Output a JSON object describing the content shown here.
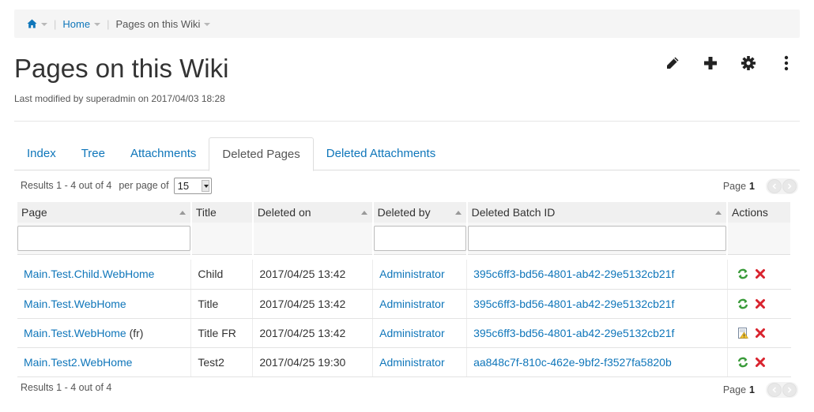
{
  "breadcrumb": {
    "home_label": "Home",
    "current": "Pages on this Wiki"
  },
  "page": {
    "title": "Pages on this Wiki",
    "modified": "Last modified by superadmin on 2017/04/03 18:28"
  },
  "top_actions": [
    "pencil-icon",
    "plus-icon",
    "gear-icon",
    "kebab-menu-icon"
  ],
  "tabs": [
    {
      "label": "Index",
      "active": false
    },
    {
      "label": "Tree",
      "active": false
    },
    {
      "label": "Attachments",
      "active": false
    },
    {
      "label": "Deleted Pages",
      "active": true
    },
    {
      "label": "Deleted Attachments",
      "active": false
    }
  ],
  "results": {
    "summary": "Results 1 - 4 out of 4",
    "per_page_label": "per page of",
    "per_page_value": "15",
    "page_label": "Page",
    "page_number": "1"
  },
  "table": {
    "columns": [
      "Page",
      "Title",
      "Deleted on",
      "Deleted by",
      "Deleted Batch ID",
      "Actions"
    ],
    "rows": [
      {
        "page": "Main.Test.Child.WebHome",
        "lang": "",
        "title": "Child",
        "deleted_on": "2017/04/25 13:42",
        "deleted_by": "Administrator",
        "batch": "395c6ff3-bd56-4801-ab42-29e5132cb21f",
        "first_action": "restore-icon"
      },
      {
        "page": "Main.Test.WebHome",
        "lang": "",
        "title": "Title",
        "deleted_on": "2017/04/25 13:42",
        "deleted_by": "Administrator",
        "batch": "395c6ff3-bd56-4801-ab42-29e5132cb21f",
        "first_action": "restore-icon"
      },
      {
        "page": "Main.Test.WebHome",
        "lang": "(fr)",
        "title": "Title FR",
        "deleted_on": "2017/04/25 13:42",
        "deleted_by": "Administrator",
        "batch": "395c6ff3-bd56-4801-ab42-29e5132cb21f",
        "first_action": "page-warning-icon"
      },
      {
        "page": "Main.Test2.WebHome",
        "lang": "",
        "title": "Test2",
        "deleted_on": "2017/04/25 19:30",
        "deleted_by": "Administrator",
        "batch": "aa848c7f-810c-462e-9bf2-f3527fa5820b",
        "first_action": "restore-icon"
      }
    ]
  },
  "footer": {
    "summary": "Results 1 - 4 out of 4",
    "page_label": "Page",
    "page_number": "1"
  },
  "colors": {
    "link": "#0f76ba",
    "delete": "#d9232e",
    "restore": "#3a9b3a"
  }
}
